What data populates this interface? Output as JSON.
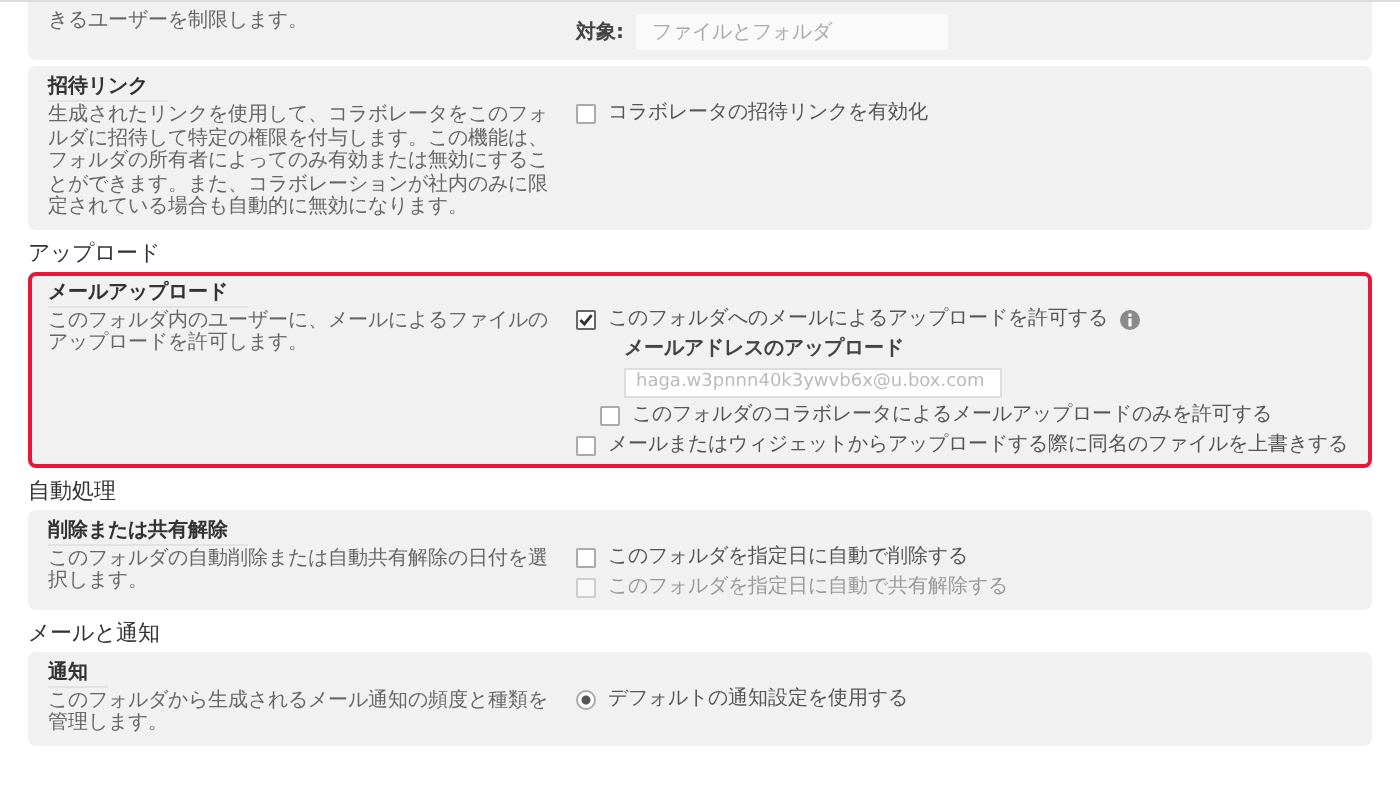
{
  "top_card": {
    "description": "きるユーザーを制限します。",
    "field": {
      "label": "対象:",
      "value": "ファイルとフォルダ"
    }
  },
  "invite_card": {
    "title": "招待リンク",
    "description": "生成されたリンクを使用して、コラボレータをこのフォルダに招待して特定の権限を付与します。この機能は、フォルダの所有者によってのみ有効または無効にすることができます。また、コラボレーションが社内のみに限定されている場合も自動的に無効になります。",
    "highlighted": false,
    "options": [
      {
        "kind": "checkbox",
        "label": "コラボレータの招待リンクを有効化",
        "checked": false,
        "disabled": false
      }
    ]
  },
  "sections": [
    {
      "heading": "アップロード",
      "cards": [
        {
          "title": "メールアップロード",
          "description": "このフォルダ内のユーザーに、メールによるファイルのアップロードを許可します。",
          "highlighted": true,
          "options": [
            {
              "kind": "checkbox",
              "label": "このフォルダへのメールによるアップロードを許可する",
              "checked": true,
              "disabled": false,
              "info": true,
              "children": [
                {
                  "kind": "address",
                  "label": "メールアドレスのアップロード",
                  "value": "haga.w3pnnn40k3ywvb6x@u.box.com",
                  "disabled": true
                },
                {
                  "kind": "checkbox",
                  "label": "このフォルダのコラボレータによるメールアップロードのみを許可する",
                  "checked": false,
                  "disabled": false
                }
              ]
            },
            {
              "kind": "checkbox",
              "label": "メールまたはウィジェットからアップロードする際に同名のファイルを上書きする",
              "checked": false,
              "disabled": false
            }
          ]
        }
      ]
    },
    {
      "heading": "自動処理",
      "cards": [
        {
          "title": "削除または共有解除",
          "description": "このフォルダの自動削除または自動共有解除の日付を選択します。",
          "highlighted": false,
          "options": [
            {
              "kind": "checkbox",
              "label": "このフォルダを指定日に自動で削除する",
              "checked": false,
              "disabled": false
            },
            {
              "kind": "checkbox",
              "label": "このフォルダを指定日に自動で共有解除する",
              "checked": false,
              "disabled": true
            }
          ]
        }
      ]
    },
    {
      "heading": "メールと通知",
      "cards": [
        {
          "title": "通知",
          "description": "このフォルダから生成されるメール通知の頻度と種類を管理します。",
          "highlighted": false,
          "options": [
            {
              "kind": "radio",
              "label": "デフォルトの通知設定を使用する",
              "selected": true,
              "disabled": false
            }
          ]
        }
      ]
    }
  ]
}
